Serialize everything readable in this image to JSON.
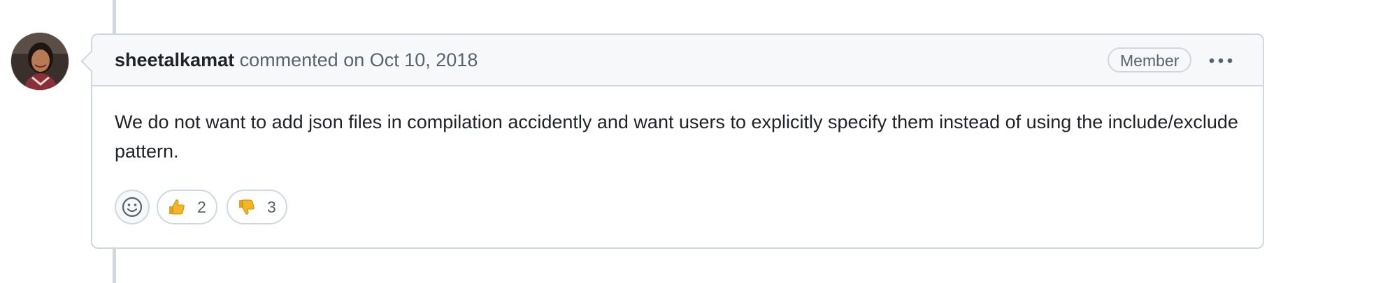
{
  "comment": {
    "author": "sheetalkamat",
    "meta_text": "commented on Oct 10, 2018",
    "badge": "Member",
    "body": "We do not want to add json files in compilation accidently and want users to explicitly specify them instead of using the include/exclude pattern.",
    "more_icon": "kebab-horizontal-icon"
  },
  "reactions": {
    "add_icon": "smiley-icon",
    "items": [
      {
        "emoji": "thumbs-up-icon",
        "count": "2"
      },
      {
        "emoji": "thumbs-down-icon",
        "count": "3"
      }
    ]
  },
  "colors": {
    "border": "#d0d7de",
    "header_bg": "#f6f8fa",
    "muted_text": "#59636e",
    "text": "#1f2328",
    "emoji_yellow": "#f5b71f"
  }
}
